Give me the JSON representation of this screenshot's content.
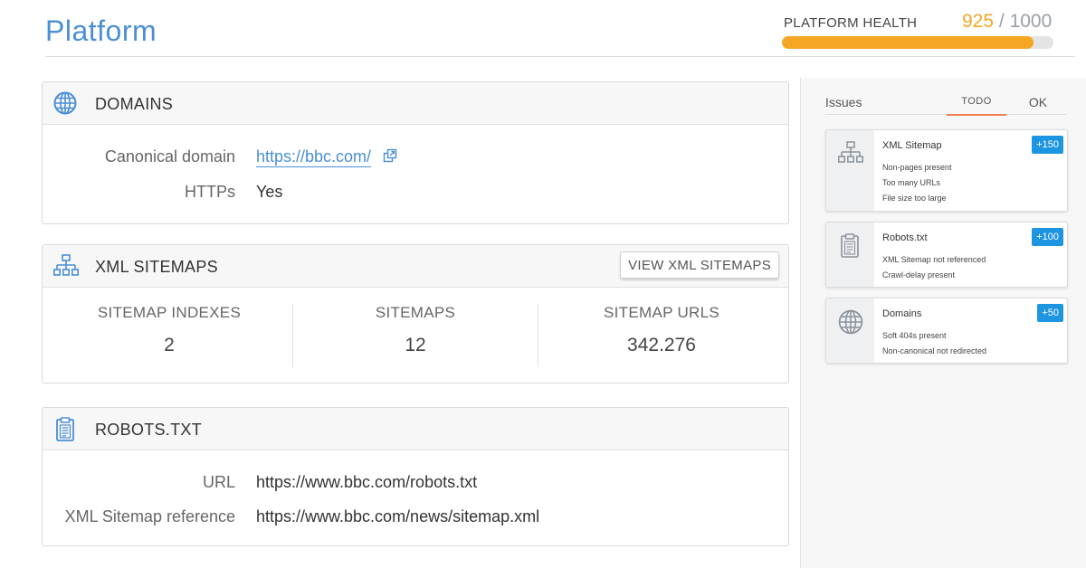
{
  "header": {
    "title": "Platform",
    "health_label": "PLATFORM HEALTH",
    "health_score": "925",
    "health_separator": "/",
    "health_max": "1000",
    "health_fraction": 0.925
  },
  "domains": {
    "title": "DOMAINS",
    "icon": "globe-icon",
    "rows": [
      {
        "key": "Canonical domain",
        "value": "https://bbc.com/"
      },
      {
        "key": "HTTPs",
        "value": "Yes"
      }
    ]
  },
  "sitemaps": {
    "title": "XML SITEMAPS",
    "icon": "sitemap-icon",
    "button_label": "VIEW XML SITEMAPS",
    "stats": [
      {
        "label": "SITEMAP INDEXES",
        "value": "2"
      },
      {
        "label": "SITEMAPS",
        "value": "12"
      },
      {
        "label": "SITEMAP URLS",
        "value": "342.276"
      }
    ]
  },
  "robots": {
    "title": "ROBOTS.TXT",
    "icon": "clipboard-icon",
    "rows": [
      {
        "key": "URL",
        "value": "https://www.bbc.com/robots.txt"
      },
      {
        "key": "XML Sitemap reference",
        "value": "https://www.bbc.com/news/sitemap.xml"
      }
    ]
  },
  "issues": {
    "label": "Issues",
    "tabs": [
      {
        "label": "TODO",
        "active": true
      },
      {
        "label": "OK",
        "active": false
      }
    ],
    "cards": [
      {
        "icon": "sitemap-icon",
        "title": "XML Sitemap",
        "badge": "+150",
        "lines": [
          "Non-pages present",
          "Too many URLs",
          "File size too large"
        ]
      },
      {
        "icon": "clipboard-icon",
        "title": "Robots.txt",
        "badge": "+100",
        "lines": [
          "XML Sitemap not referenced",
          "Crawl-delay present"
        ]
      },
      {
        "icon": "globe-icon",
        "title": "Domains",
        "badge": "+50",
        "lines": [
          "Soft 404s present",
          "Non-canonical not redirected"
        ]
      }
    ]
  },
  "colors": {
    "accent": "#4a8fd6",
    "health": "#f5a623",
    "badge": "#1e95e0",
    "tab_active": "#f07e4e"
  }
}
